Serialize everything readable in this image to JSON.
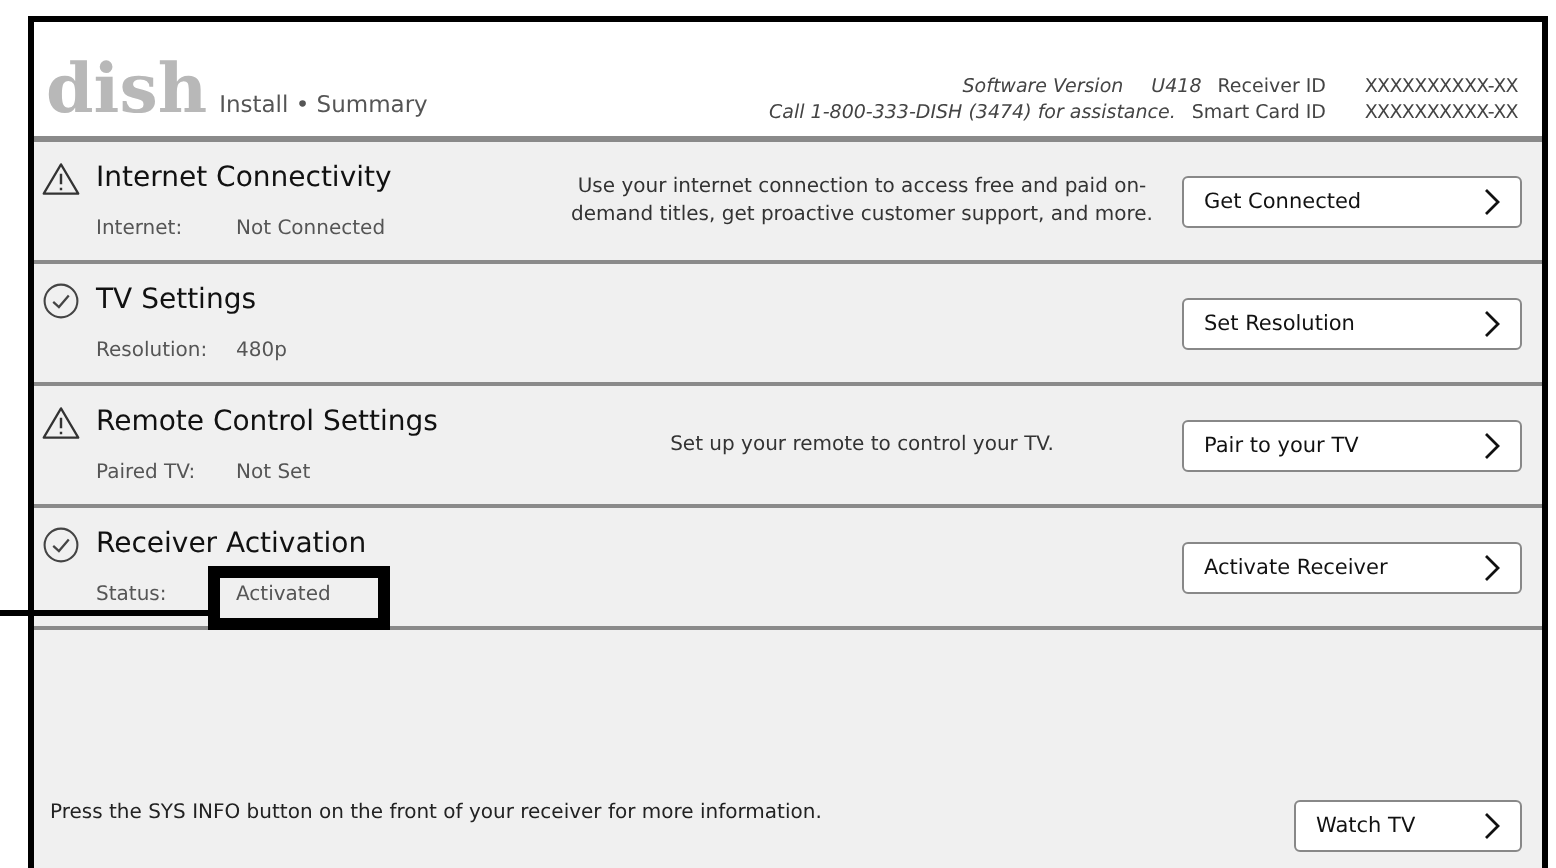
{
  "header": {
    "logo": "dish",
    "breadcrumb": "Install • Summary",
    "software_label": "Software Version",
    "software_version": "U418",
    "support": "Call 1-800-333-DISH (3474) for assistance.",
    "receiver_id_label": "Receiver ID",
    "receiver_id": "XXXXXXXXXX-XX",
    "smart_card_label": "Smart Card ID",
    "smart_card_id": "XXXXXXXXXX-XX"
  },
  "sections": [
    {
      "kind": "warning",
      "title": "Internet Connectivity",
      "label": "Internet:",
      "value": "Not Connected",
      "description": "Use your internet connection to access free and paid on-demand titles, get proactive customer support, and more.",
      "button": "Get Connected",
      "highlighted": false
    },
    {
      "kind": "done",
      "title": "TV Settings",
      "label": "Resolution:",
      "value": "480p",
      "button": "Set Resolution",
      "highlighted": false
    },
    {
      "kind": "warning",
      "title": "Remote Control Settings",
      "label": "Paired TV:",
      "value": "Not Set",
      "description": "Set up your remote to control your TV.",
      "button": "Pair to your TV",
      "highlighted": false
    },
    {
      "kind": "done",
      "title": "Receiver Activation",
      "label": "Status:",
      "value": "Activated",
      "button": "Activate Receiver",
      "highlighted": true
    }
  ],
  "footer": {
    "message": "Press the SYS INFO button on the front of your receiver for more information.",
    "button": "Watch TV"
  }
}
